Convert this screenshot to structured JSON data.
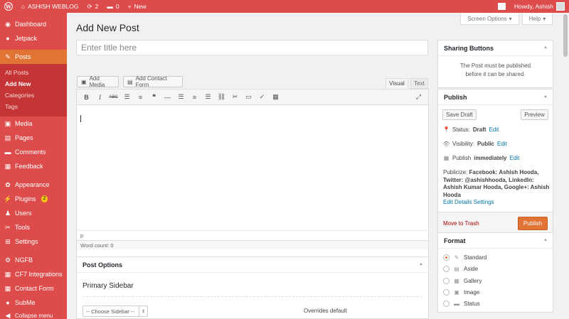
{
  "adminbar": {
    "site_name": "ASHISH WEBLOG",
    "updates_count": "2",
    "comments_count": "0",
    "new_label": "New",
    "howdy": "Howdy, Ashish"
  },
  "sidebar": {
    "dashboard": "Dashboard",
    "jetpack": "Jetpack",
    "posts": "Posts",
    "posts_sub": [
      "All Posts",
      "Add New",
      "Categories",
      "Tags"
    ],
    "media": "Media",
    "pages": "Pages",
    "comments": "Comments",
    "feedback": "Feedback",
    "appearance": "Appearance",
    "plugins": "Plugins",
    "plugins_badge": "2",
    "users": "Users",
    "tools": "Tools",
    "settings": "Settings",
    "ngfb": "NGFB",
    "cf7": "CF7 Integrations",
    "contact_form": "Contact Form",
    "subme": "SubMe",
    "collapse": "Collapse menu"
  },
  "header": {
    "screen_options": "Screen Options",
    "help": "Help",
    "title": "Add New Post"
  },
  "title_input": {
    "placeholder": "Enter title here"
  },
  "editor": {
    "add_media": "Add Media",
    "add_contact_form": "Add Contact Form",
    "tab_visual": "Visual",
    "tab_text": "Text",
    "path": "p",
    "word_count": "Word count: 0"
  },
  "post_options": {
    "title": "Post Options",
    "primary_sidebar": "Primary Sidebar",
    "choose_sidebar": "-- Choose Sidebar --",
    "overrides": "Overrides default"
  },
  "sharing": {
    "title": "Sharing Buttons",
    "message_line1": "The Post must be published",
    "message_line2": "before it can be shared."
  },
  "publish": {
    "title": "Publish",
    "save_draft": "Save Draft",
    "preview": "Preview",
    "status_label": "Status:",
    "status_value": "Draft",
    "visibility_label": "Visibility:",
    "visibility_value": "Public",
    "publish_label": "Publish",
    "publish_value": "immediately",
    "edit": "Edit",
    "publicize_label": "Publicize:",
    "publicize_value": "Facebook: Ashish Hooda, Twitter: @ashishhooda, LinkedIn: Ashish Kumar Hooda, Google+: Ashish Hooda",
    "edit_details": "Edit Details",
    "settings": "Settings",
    "move_to_trash": "Move to Trash",
    "publish_button": "Publish"
  },
  "format": {
    "title": "Format",
    "options": [
      "Standard",
      "Aside",
      "Gallery",
      "Image",
      "Status"
    ],
    "selected": "Standard"
  },
  "colors": {
    "admin_red": "#dd4b4b",
    "accent_orange": "#e17335",
    "link_blue": "#0073aa"
  }
}
